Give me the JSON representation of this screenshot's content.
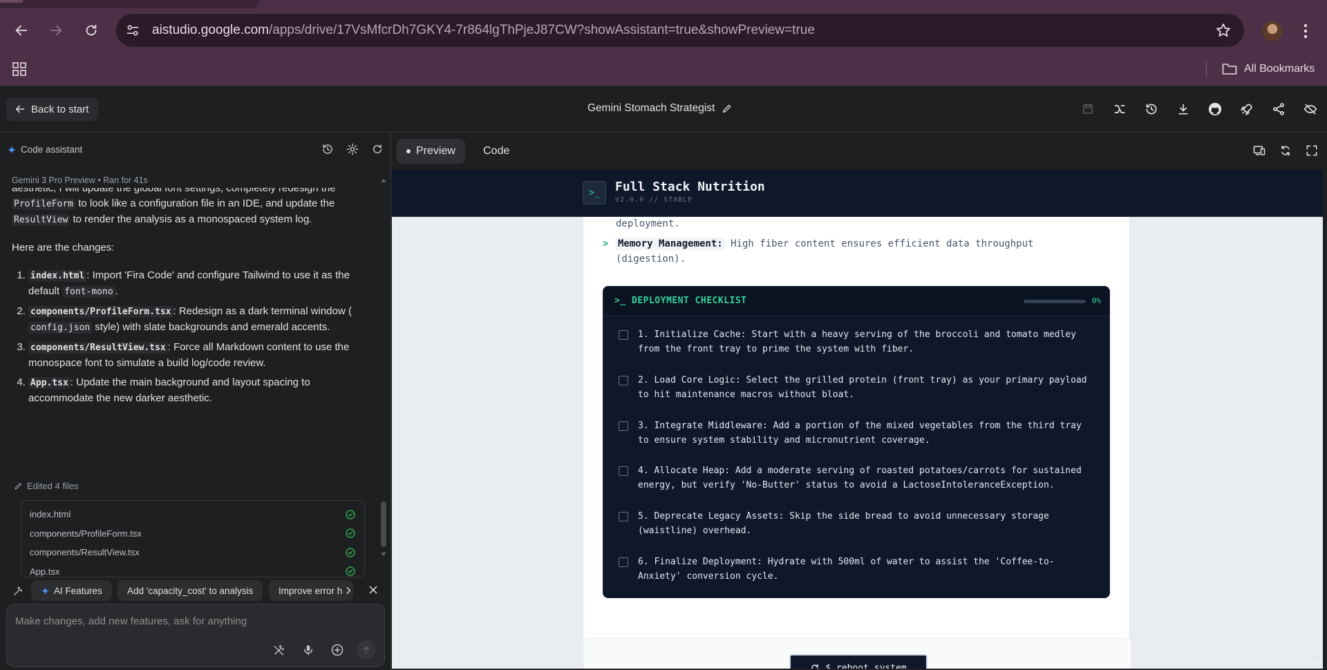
{
  "browser": {
    "url_host": "aistudio.google.com",
    "url_path": "/apps/drive/17VsMfcrDh7GKY4-7r864lgThPjeJ87CW?showAssistant=true&showPreview=true",
    "bookmarks_label": "All Bookmarks"
  },
  "header": {
    "back_label": "Back to start",
    "app_title": "Gemini Stomach Strategist"
  },
  "assistant": {
    "title": "Code assistant",
    "model": "Gemini 3 Pro Preview",
    "run_status": "Ran for 41s",
    "intro_a": "aesthetic, I will update the global font settings, completely redesign the ",
    "intro_code1": "ProfileForm",
    "intro_b": " to look like a configuration file in an IDE, and update the ",
    "intro_code2": "ResultView",
    "intro_c": " to render the analysis as a monospaced system log.",
    "changes_heading": "Here are the changes:",
    "changes": [
      {
        "file": "index.html",
        "text_a": ": Import 'Fira Code' and configure Tailwind to use it as the default ",
        "code": "font-mono",
        "text_b": "."
      },
      {
        "file": "components/ProfileForm.tsx",
        "text_a": ": Redesign as a dark terminal window ( ",
        "code": "config.json",
        "text_b": " style) with slate backgrounds and emerald accents."
      },
      {
        "file": "components/ResultView.tsx",
        "text_a": ": Force all Markdown content to use the monospace font to simulate a build log/code review.",
        "code": "",
        "text_b": ""
      },
      {
        "file": "App.tsx",
        "text_a": ": Update the main background and layout spacing to accommodate the new darker aesthetic.",
        "code": "",
        "text_b": ""
      }
    ],
    "edited_label": "Edited 4 files",
    "edited_files": [
      "index.html",
      "components/ProfileForm.tsx",
      "components/ResultView.tsx",
      "App.tsx"
    ],
    "suggestions": [
      "AI Features",
      "Add 'capacity_cost' to analysis",
      "Improve error h"
    ],
    "input_placeholder": "Make changes, add new features, ask for anything"
  },
  "preview_tabs": {
    "preview": "Preview",
    "code": "Code"
  },
  "site": {
    "logo": ">_",
    "title": "Full Stack Nutrition",
    "version": "V2.0.0 // STABLE",
    "deploy_tail": "deployment.",
    "mem_arrow": ">",
    "mem_key": "Memory Management:",
    "mem_text_a": " High fiber content ensures efficient data throughput",
    "mem_text_b": "(digestion).",
    "checklist_title": ">_ DEPLOYMENT CHECKLIST",
    "progress_fraction": 0,
    "progress_label": "0%",
    "checklist": [
      {
        "line1": "1. Initialize Cache: Start with a heavy serving of the broccoli and tomato medley",
        "line2": "from the front tray to prime the system with fiber."
      },
      {
        "line1": "2. Load Core Logic: Select the grilled protein (front tray) as your primary payload",
        "line2": "to hit maintenance macros without bloat."
      },
      {
        "line1": "3. Integrate Middleware: Add a portion of the mixed vegetables from the third tray",
        "line2": "to ensure system stability and micronutrient coverage."
      },
      {
        "line1": "4. Allocate Heap: Add a moderate serving of roasted potatoes/carrots for sustained",
        "line2": "energy, but verify 'No-Butter' status to avoid a LactoseIntoleranceException."
      },
      {
        "line1": "5. Deprecate Legacy Assets: Skip the side bread to avoid unnecessary storage",
        "line2": "(waistline) overhead."
      },
      {
        "line1": "6. Finalize Deployment: Hydrate with 500ml of water to assist the 'Coffee-to-",
        "line2": "Anxiety' conversion cycle."
      }
    ],
    "reboot_label": "$ reboot_system"
  }
}
